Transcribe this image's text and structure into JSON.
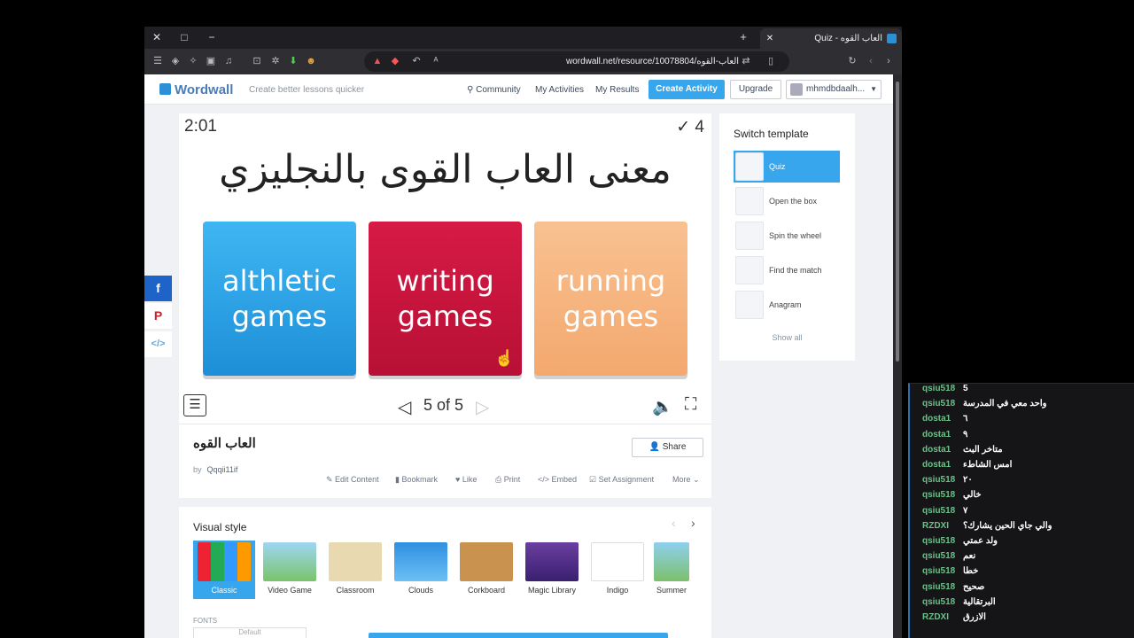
{
  "browser": {
    "tab_title": "العاب القوه - Quiz",
    "url": "wordwall.net/resource/10078804/العاب-القوه",
    "tab_close": "✕",
    "new_tab": "+",
    "win_close": "✕",
    "win_max": "□",
    "win_min": "−"
  },
  "nav": {
    "logo": "Wordwall",
    "tagline": "Create better lessons quicker",
    "community": "Community",
    "my_activities": "My Activities",
    "my_results": "My Results",
    "create_activity": "Create Activity",
    "upgrade": "Upgrade",
    "user": "mhmdbdaalh..."
  },
  "game": {
    "timer": "2:01",
    "score": "✓ 4",
    "question": "معنى العاب القوى بالنجليزي",
    "answers": [
      "althletic games",
      "writing games",
      "running games"
    ],
    "answer_colors": [
      "#2aa2e6",
      "#c8143e",
      "#f5b27d"
    ],
    "pager": "5 of 5",
    "menu": "☰",
    "prev": "◁",
    "next": "▷",
    "sound": "🔈",
    "fullscreen": "⛶"
  },
  "info": {
    "title": "العاب القوه",
    "share": "Share",
    "by": "by",
    "author": "Qqqii11if",
    "actions": {
      "edit": "Edit Content",
      "bookmark": "Bookmark",
      "like": "Like",
      "print": "Print",
      "embed": "Embed",
      "assignment": "Set Assignment",
      "more": "More"
    }
  },
  "visual_style": {
    "title": "Visual style",
    "themes": [
      "Classic",
      "Video Game",
      "Classroom",
      "Clouds",
      "Corkboard",
      "Magic Library",
      "Indigo",
      "Summer"
    ],
    "selected": "Classic",
    "fonts_label": "FONTS",
    "font_value": "Default"
  },
  "switch_template": {
    "title": "Switch template",
    "items": [
      "Quiz",
      "Open the box",
      "Spin the wheel",
      "Find the match",
      "Anagram"
    ],
    "selected": "Quiz",
    "show_all": "Show all"
  },
  "chat": [
    {
      "user": "qsiu518",
      "msg": "5"
    },
    {
      "user": "qsiu518",
      "msg": "واحد معي في المدرسة"
    },
    {
      "user": "dosta1",
      "msg": "٦"
    },
    {
      "user": "dosta1",
      "msg": "٩"
    },
    {
      "user": "dosta1",
      "msg": "متاخر البث"
    },
    {
      "user": "dosta1",
      "msg": "امس الشاطء"
    },
    {
      "user": "qsiu518",
      "msg": "٢٠"
    },
    {
      "user": "qsiu518",
      "msg": "خالي"
    },
    {
      "user": "qsiu518",
      "msg": "٧"
    },
    {
      "user": "RZDXI",
      "msg": "والي جاي الحين يشارك؟"
    },
    {
      "user": "qsiu518",
      "msg": "ولد عمتي"
    },
    {
      "user": "qsiu518",
      "msg": "نعم"
    },
    {
      "user": "qsiu518",
      "msg": "خطا"
    },
    {
      "user": "qsiu518",
      "msg": "صحيح"
    },
    {
      "user": "qsiu518",
      "msg": "البرتقالية"
    },
    {
      "user": "RZDXI",
      "msg": "الازرق"
    }
  ]
}
